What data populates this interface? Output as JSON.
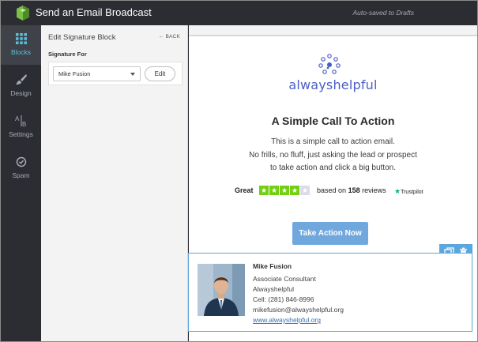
{
  "app": {
    "title": "Send an Email Broadcast",
    "autosave": "Auto-saved to Drafts",
    "accent": "#5bc0de",
    "bar_color": "#2b2d33"
  },
  "nav": {
    "items": [
      {
        "label": "Blocks",
        "icon": "grid-icon",
        "active": true
      },
      {
        "label": "Design",
        "icon": "brush-icon",
        "active": false
      },
      {
        "label": "Settings",
        "icon": "ab-icon",
        "active": false
      },
      {
        "label": "Spam",
        "icon": "check-circle-icon",
        "active": false
      }
    ]
  },
  "panel": {
    "title": "Edit Signature Block",
    "back_label": "BACK",
    "signature_for_label": "Signature For",
    "selected_signature": "Mike Fusion",
    "edit_label": "Edit"
  },
  "email": {
    "brand_name": "alwayshelpful",
    "brand_color": "#4a5ec8",
    "heading": "A Simple Call To Action",
    "body_lines": [
      "This is a simple call to action email.",
      "No frills, no fluff, just asking the lead or prospect",
      "to take action and click a big button."
    ],
    "trustpilot": {
      "rating_word": "Great",
      "stars_filled": 4,
      "stars_total": 5,
      "based_on_prefix": "based on",
      "review_count": "158",
      "reviews_suffix": "reviews",
      "logo_text": "Trustpilot"
    },
    "cta_label": "Take Action Now",
    "cta_color": "#70a8de"
  },
  "signature": {
    "name": "Mike Fusion",
    "title": "Associate Consultant",
    "company": "Alwayshelpful",
    "cell": "Cell: (281) 846-8996",
    "email": "mikefusion@alwayshelpful.org",
    "website": "www.alwayshelpful.org",
    "border_color": "#5ba6dc"
  }
}
